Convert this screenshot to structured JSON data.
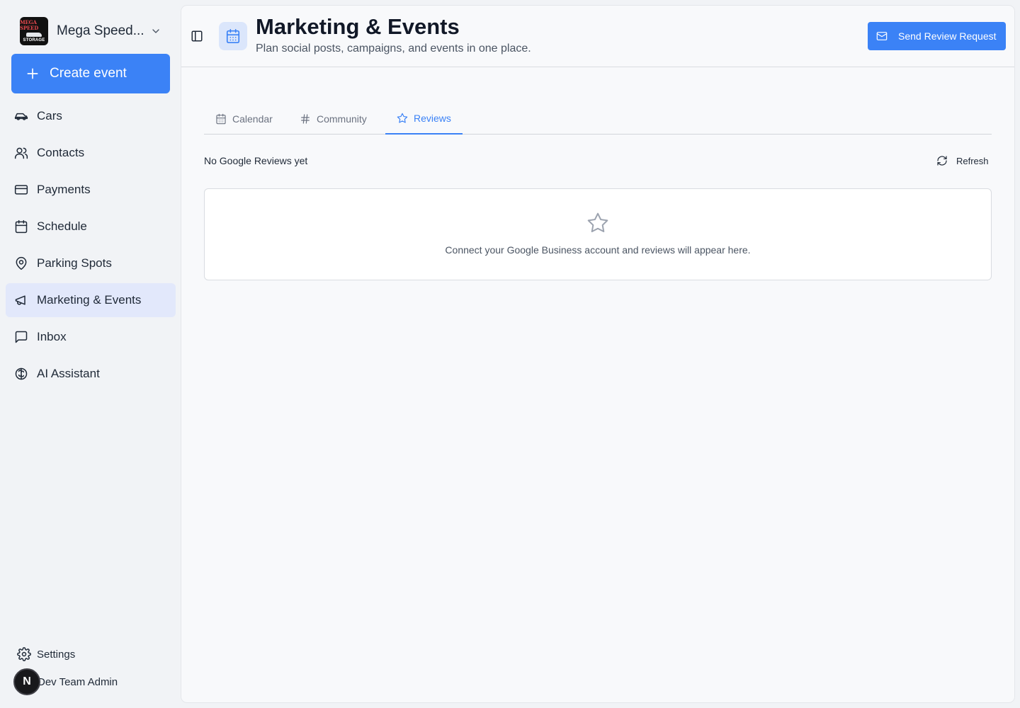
{
  "sidebar": {
    "org_name": "Mega Speed...",
    "logo": {
      "line1": "MEGA SPEED",
      "line3": "STORAGE"
    },
    "create_label": "Create event",
    "items": [
      {
        "label": "Cars",
        "icon": "car-icon"
      },
      {
        "label": "Contacts",
        "icon": "users-icon"
      },
      {
        "label": "Payments",
        "icon": "credit-card-icon"
      },
      {
        "label": "Schedule",
        "icon": "calendar-icon"
      },
      {
        "label": "Parking Spots",
        "icon": "map-pin-icon"
      },
      {
        "label": "Marketing & Events",
        "icon": "megaphone-icon",
        "active": true
      },
      {
        "label": "Inbox",
        "icon": "message-square-icon"
      },
      {
        "label": "AI Assistant",
        "icon": "brain-icon"
      }
    ],
    "settings_label": "Settings",
    "user": {
      "initial": "N",
      "name": "Dev Team Admin"
    }
  },
  "header": {
    "title": "Marketing & Events",
    "subtitle": "Plan social posts, campaigns, and events in one place.",
    "send_review_label": "Send Review Request"
  },
  "tabs": [
    {
      "label": "Calendar",
      "icon": "calendar-icon"
    },
    {
      "label": "Community",
      "icon": "hash-icon"
    },
    {
      "label": "Reviews",
      "icon": "star-icon",
      "active": true
    }
  ],
  "reviews": {
    "status_text": "No Google Reviews yet",
    "refresh_label": "Refresh",
    "empty_message": "Connect your Google Business account and reviews will appear here."
  },
  "colors": {
    "accent": "#3b82f6",
    "active_nav_bg": "#e2e8fb",
    "sidebar_bg": "#f1f3f6",
    "panel_bg": "#f8f9fb"
  }
}
